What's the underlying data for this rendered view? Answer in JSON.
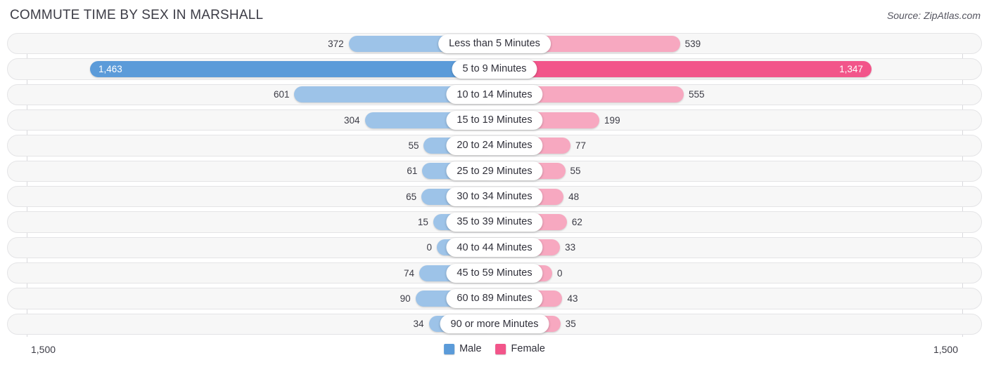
{
  "header": {
    "title": "COMMUTE TIME BY SEX IN MARSHALL",
    "source": "Source: ZipAtlas.com"
  },
  "axis": {
    "left_max_label": "1,500",
    "right_max_label": "1,500"
  },
  "legend": {
    "items": [
      {
        "label": "Male",
        "color": "#5b9bd9"
      },
      {
        "label": "Female",
        "color": "#f2558a"
      }
    ]
  },
  "colors": {
    "male_normal": "#9dc3e8",
    "male_max": "#5b9bd9",
    "female_normal": "#f7a8c0",
    "female_max": "#f2558a",
    "track_fill": "#f7f7f7",
    "track_border": "#e4e4e6",
    "text": "#3c3c46"
  },
  "chart_data": {
    "type": "bar",
    "subtype": "diverging-bar",
    "title": "COMMUTE TIME BY SEX IN MARSHALL",
    "xlabel": "",
    "ylabel": "",
    "axis_max": 1500,
    "grid": false,
    "legend_position": "bottom-center",
    "categories": [
      "Less than 5 Minutes",
      "5 to 9 Minutes",
      "10 to 14 Minutes",
      "15 to 19 Minutes",
      "20 to 24 Minutes",
      "25 to 29 Minutes",
      "30 to 34 Minutes",
      "35 to 39 Minutes",
      "40 to 44 Minutes",
      "45 to 59 Minutes",
      "60 to 89 Minutes",
      "90 or more Minutes"
    ],
    "series": [
      {
        "name": "Male",
        "side": "left",
        "values": [
          372,
          1463,
          601,
          304,
          55,
          61,
          65,
          15,
          0,
          74,
          90,
          34
        ],
        "labels": [
          "372",
          "1,463",
          "601",
          "304",
          "55",
          "61",
          "65",
          "15",
          "0",
          "74",
          "90",
          "34"
        ]
      },
      {
        "name": "Female",
        "side": "right",
        "values": [
          539,
          1347,
          555,
          199,
          77,
          55,
          48,
          62,
          33,
          0,
          43,
          35
        ],
        "labels": [
          "539",
          "1,347",
          "555",
          "199",
          "77",
          "55",
          "48",
          "62",
          "33",
          "0",
          "43",
          "35"
        ]
      }
    ]
  }
}
